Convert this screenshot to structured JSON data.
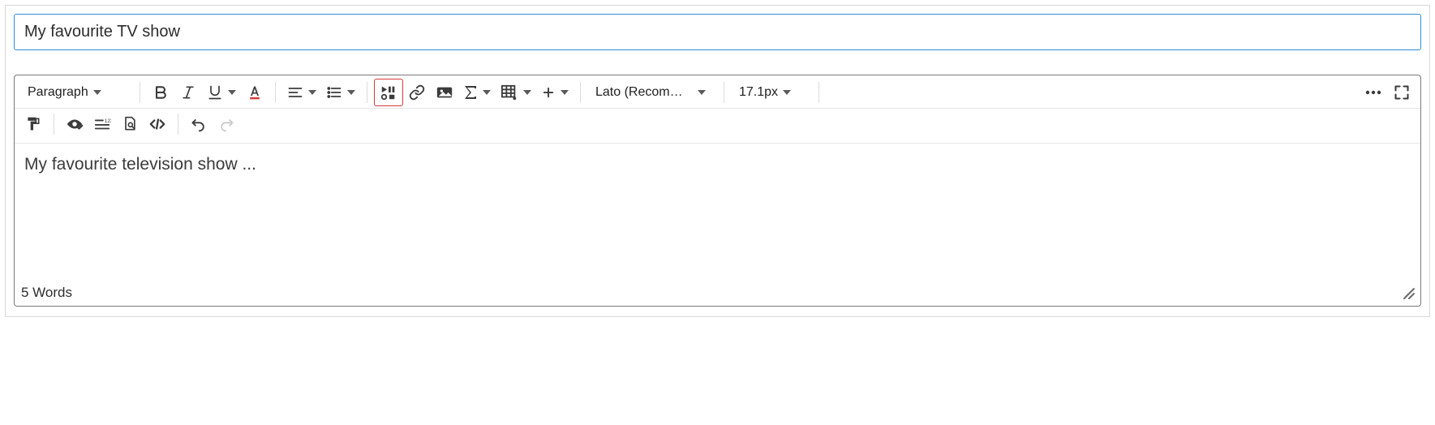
{
  "title_value": "My favourite TV show",
  "toolbar": {
    "paragraph_label": "Paragraph",
    "font_label": "Lato (Recomm…",
    "size_label": "17.1px"
  },
  "body_text": "My favourite television show ...",
  "status": {
    "word_count": "5 Words"
  }
}
